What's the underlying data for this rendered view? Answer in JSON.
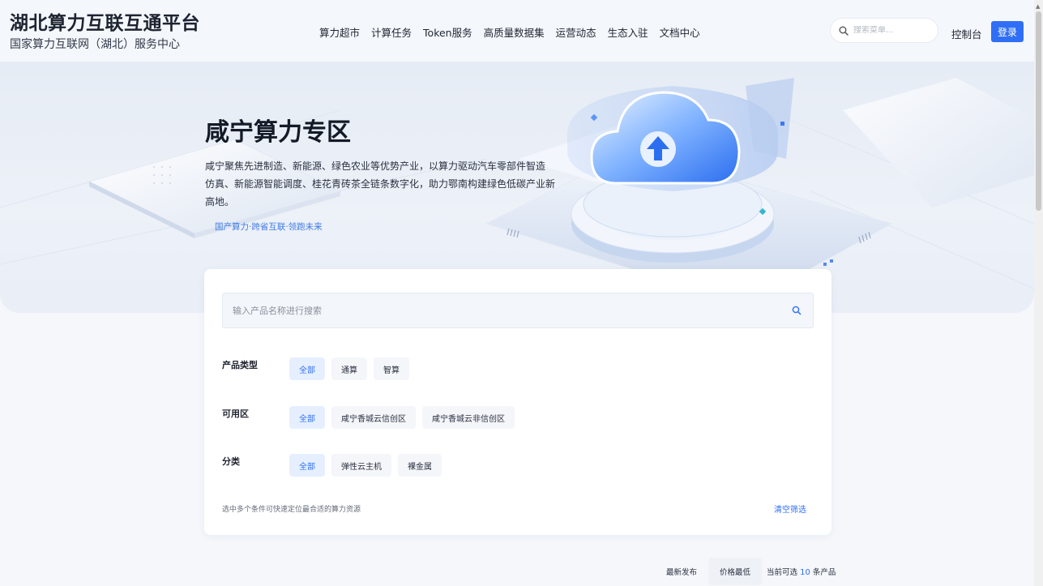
{
  "header": {
    "brand_title": "湖北算力互联互通平台",
    "brand_subtitle": "国家算力互联网（湖北）服务中心",
    "nav": [
      "算力超市",
      "计算任务",
      "Token服务",
      "高质量数据集",
      "运营动态",
      "生态入驻",
      "文档中心"
    ],
    "search_placeholder": "搜索菜单...",
    "console_label": "控制台",
    "login_label": "登录"
  },
  "hero": {
    "title": "咸宁算力专区",
    "description_line1": "咸宁聚焦先进制造、新能源、绿色农业等优势产业，以算力驱动汽车零部件智造",
    "description_line2": "仿真、新能源智能调度、桂花青砖茶全链条数字化，助力鄂南构建绿色低碳产业新高地。",
    "tagline": "国产算力·跨省互联·领跑未来"
  },
  "filters": {
    "search_placeholder": "输入产品名称进行搜索",
    "rows": [
      {
        "label": "产品类型",
        "options": [
          "全部",
          "通算",
          "智算"
        ],
        "active": 0
      },
      {
        "label": "可用区",
        "options": [
          "全部",
          "咸宁香城云信创区",
          "咸宁香城云非信创区"
        ],
        "active": 0
      },
      {
        "label": "分类",
        "options": [
          "全部",
          "弹性云主机",
          "裸金属"
        ],
        "active": 0
      }
    ],
    "hint": "选中多个条件可快速定位最合适的算力资源",
    "clear_label": "清空筛选"
  },
  "results": {
    "sort_latest": "最新发布",
    "sort_price": "价格最低",
    "count_prefix": "当前可选",
    "count": "10",
    "count_suffix": "条产品"
  },
  "colors": {
    "accent": "#2f6ff5",
    "active_chip_bg": "#e6efff",
    "hero_bg": "#e9eef6"
  },
  "icons": {
    "search": "search-icon",
    "hero_illustration": "cloud-upload-icon"
  }
}
